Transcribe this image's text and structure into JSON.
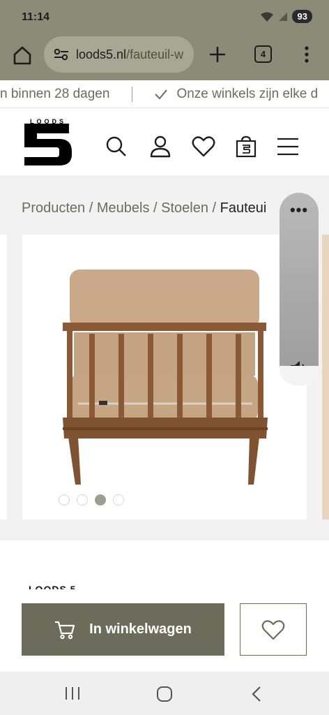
{
  "status_bar": {
    "time": "11:14",
    "battery": "93"
  },
  "browser": {
    "url_domain": "loods5.nl",
    "url_path": "/fauteuil-w",
    "tab_count": "4"
  },
  "promo_ticker": {
    "item1": "n binnen 28 dagen",
    "item2": "Onze winkels zijn elke d"
  },
  "header": {
    "logo_text": "LOODS",
    "logo_number": "5"
  },
  "breadcrumb": {
    "items": [
      "Producten",
      "Meubels",
      "Stoelen"
    ],
    "separator": " / ",
    "current": "Fauteui"
  },
  "gallery": {
    "image_count": 4,
    "active_index": 2
  },
  "volume_panel": {
    "more_icon": "more-horiz-icon",
    "speaker_icon": "volume-icon"
  },
  "product": {
    "brand_peek": "LOODS 5"
  },
  "cta": {
    "add_to_cart_label": "In winkelwagen"
  },
  "colors": {
    "accent": "#6b6d5a",
    "browser_bar": "#8a8c78",
    "muted_text": "#6b6d5c"
  }
}
